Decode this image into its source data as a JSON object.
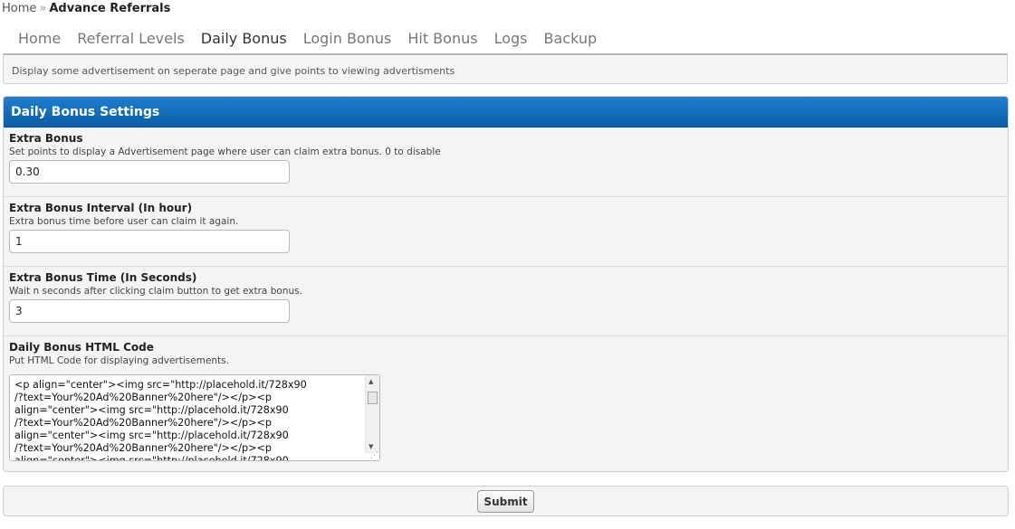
{
  "breadcrumb": {
    "home": "Home",
    "separator": "»",
    "current": "Advance Referrals"
  },
  "tabs": [
    {
      "label": "Home",
      "active": false
    },
    {
      "label": "Referral Levels",
      "active": false
    },
    {
      "label": "Daily Bonus",
      "active": true
    },
    {
      "label": "Login Bonus",
      "active": false
    },
    {
      "label": "Hit Bonus",
      "active": false
    },
    {
      "label": "Logs",
      "active": false
    },
    {
      "label": "Backup",
      "active": false
    }
  ],
  "description": "Display some advertisement on seperate page and give points to viewing advertisments",
  "panel": {
    "title": "Daily Bonus Settings",
    "header_color": "#0b67b5",
    "fields": [
      {
        "label": "Extra Bonus",
        "help": "Set points to display a Advertisement page where user can claim extra bonus. 0 to disable",
        "value": "0.30"
      },
      {
        "label": "Extra Bonus Interval (In hour)",
        "help": "Extra bonus time before user can claim it again.",
        "value": "1"
      },
      {
        "label": "Extra Bonus Time (In Seconds)",
        "help": "Wait n seconds after clicking claim button to get extra bonus.",
        "value": "3"
      }
    ],
    "html_code": {
      "label": "Daily Bonus HTML Code",
      "help": "Put HTML Code for displaying advertisements.",
      "value": "<p align=\"center\"><img src=\"http://placehold.it/728x90\n/?text=Your%20Ad%20Banner%20here\"/></p><p\nalign=\"center\"><img src=\"http://placehold.it/728x90\n/?text=Your%20Ad%20Banner%20here\"/></p><p\nalign=\"center\"><img src=\"http://placehold.it/728x90\n/?text=Your%20Ad%20Banner%20here\"/></p><p\nalign=\"center\"><img src=\"http://placehold.it/728x90"
    }
  },
  "submit_label": "Submit"
}
